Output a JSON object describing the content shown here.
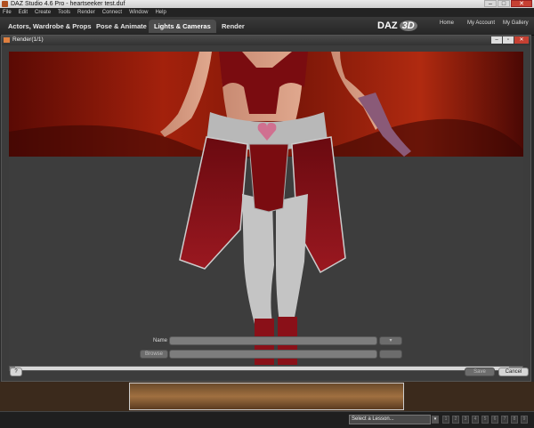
{
  "window": {
    "title": "DAZ Studio 4.6 Pro - heartseeker test.duf"
  },
  "menu": [
    "File",
    "Edit",
    "Create",
    "Tools",
    "Render",
    "Connect",
    "Window",
    "Help"
  ],
  "tabs": [
    "Actors, Wardrobe & Props",
    "Pose & Animate",
    "Lights & Cameras",
    "Render"
  ],
  "active_tab": "Lights & Cameras",
  "brand": {
    "logo_left": "DAZ",
    "logo_right": "3D"
  },
  "top_links": [
    "Home",
    "My Account",
    "My Gallery"
  ],
  "render_window": {
    "title": "Render(1/1)",
    "name_label": "Name",
    "name_value": "",
    "browse_label": "Browse",
    "path_value": "",
    "help_label": "?",
    "save_label": "Save",
    "cancel_label": "Cancel"
  },
  "statusbar": {
    "lesson_select": "Select a Lesson...",
    "steps": [
      "1",
      "2",
      "3",
      "4",
      "5",
      "6",
      "7",
      "8",
      "9"
    ]
  },
  "colors": {
    "bg_dark": "#2a2a2a",
    "backdrop_red": "#8a1a0a",
    "floor": "#3d3d3d"
  }
}
